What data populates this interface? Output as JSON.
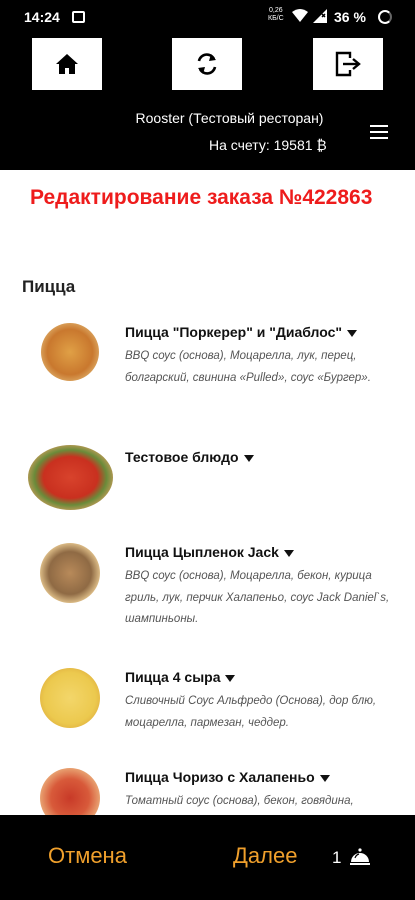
{
  "status_bar": {
    "time": "14:24",
    "net_speed_top": "0,26",
    "net_speed_bottom": "КБ/С",
    "battery": "36 %"
  },
  "header": {
    "icons": {
      "home": "home-icon",
      "refresh": "refresh-icon",
      "logout": "logout-icon",
      "menu": "hamburger-menu-icon"
    },
    "restaurant": "Rooster (Тестовый ресторан)",
    "balance": "На счету: 19581 ₿"
  },
  "order_title": "Редактирование заказа №422863",
  "section_title": "Пицца",
  "items": [
    {
      "name": "Пицца \"Поркерер\" и \"Диаблос\"",
      "desc": "BBQ соус (основа), Моцарелла, лук, перец, болгарский, свинина «Pulled», соус «Бургер»."
    },
    {
      "name": "Тестовое блюдо",
      "desc": ""
    },
    {
      "name": "Пицца Цыпленок Jack",
      "desc": "BBQ соус (основа), Моцарелла, бекон, курица гриль, лук, перчик Халапеньо, соус Jack Daniel`s, шампиньоны."
    },
    {
      "name": "Пицца 4 сыра",
      "desc": "Сливочный Соус Альфредо (Основа), дор блю, моцарелла, пармезан, чеддер."
    },
    {
      "name": "Пицца Чоризо с Халапеньо",
      "desc": "Томатный соус (основа), бекон, говядина,"
    }
  ],
  "footer": {
    "cancel": "Отмена",
    "next": "Далее",
    "cart_count": "1",
    "cart_icon": "serving-cloche-icon"
  },
  "colors": {
    "accent": "#f0a02c",
    "title_red": "#ee1c1c",
    "header_bg": "#000000"
  }
}
